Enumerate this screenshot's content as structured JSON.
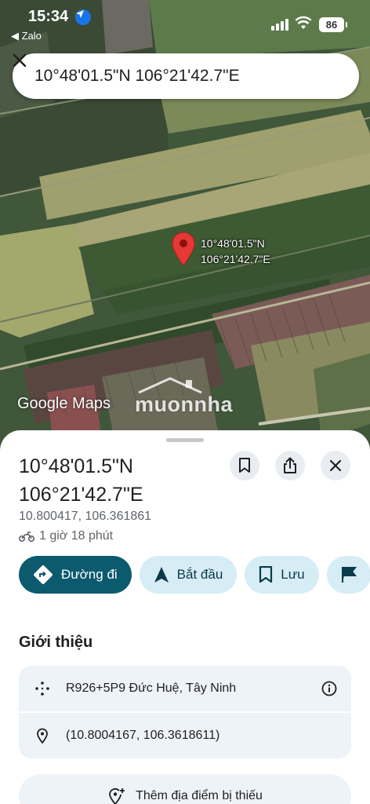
{
  "status_bar": {
    "time": "15:34",
    "back_app": "◀ Zalo",
    "battery": "86"
  },
  "search": {
    "query": "10°48'01.5\"N 106°21'42.7\"E"
  },
  "map": {
    "pin_label_lat": "10°48'01.5\"N",
    "pin_label_lng": "106°21'42.7\"E",
    "google_watermark": "Google Maps",
    "site_watermark": "muonnha"
  },
  "place": {
    "title_line1": "10°48'01.5\"N",
    "title_line2": "106°21'42.7\"E",
    "decimal_coords": "10.800417, 106.361861",
    "eta": "1 giờ 18 phút"
  },
  "actions": {
    "directions": "Đường đi",
    "start": "Bắt đầu",
    "save": "Lưu"
  },
  "about": {
    "title": "Giới thiệu",
    "plus_code": "R926+5P9 Đức Huệ, Tây Ninh",
    "coordinates": "(10.8004167, 106.3618611)"
  },
  "add_missing_place": "Thêm địa điểm bị thiếu"
}
